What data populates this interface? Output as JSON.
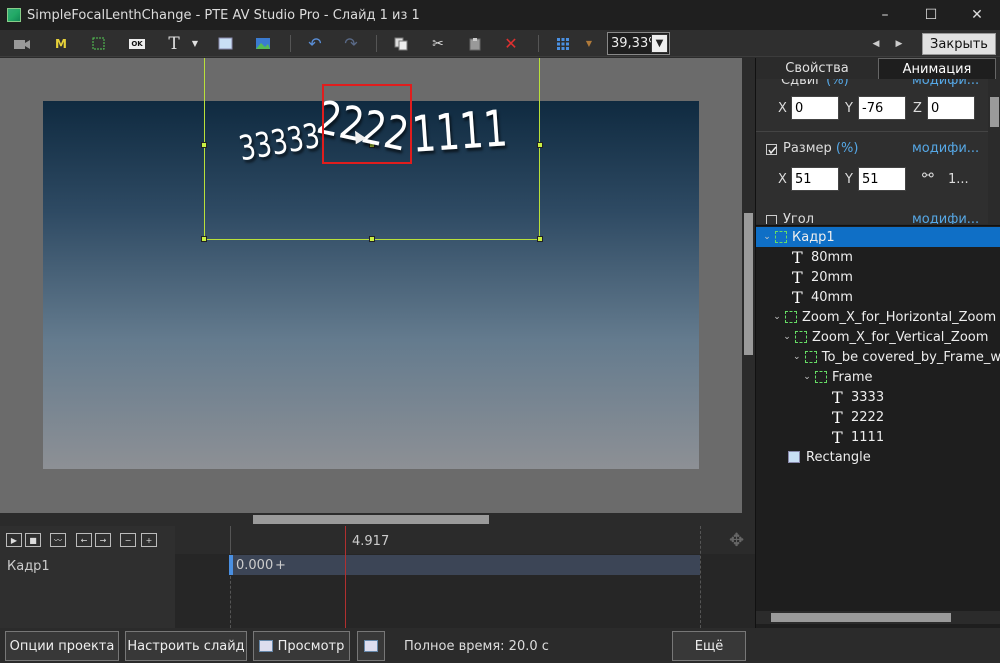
{
  "window": {
    "title": "SimpleFocalLenthChange - PTE AV Studio Pro - Слайд 1 из 1",
    "minimize": "–",
    "maximize": "☐",
    "close": "✕"
  },
  "toolbar": {
    "icons": [
      "camera-icon",
      "mask-icon",
      "frame-icon",
      "button-icon",
      "text-icon",
      "rectangle-icon",
      "image-icon",
      "undo-icon",
      "redo-icon",
      "copy-icon",
      "cut-icon",
      "paste-icon",
      "delete-icon",
      "grid-icon",
      "color-icon"
    ],
    "mask_label": "M",
    "text_label": "T",
    "button_label": "OK",
    "zoom_value": "39,33%",
    "nav_prev": "◀",
    "nav_next": "▶",
    "close_label": "Закрыть"
  },
  "canvas": {
    "text_3333": "33333",
    "text_2222": "2222",
    "text_1111": "1111"
  },
  "panel": {
    "tab_properties": "Свойства",
    "tab_animation": "Анимация",
    "shift_label": "Сдвиг",
    "shift_unit": "(%)",
    "shift_modify": "модифи...",
    "shift_x_label": "X",
    "shift_x": "0",
    "shift_y_label": "Y",
    "shift_y": "-76",
    "shift_z_label": "Z",
    "shift_z": "0",
    "size_label": "Размер",
    "size_unit": "(%)",
    "size_modify": "модифи...",
    "size_x_label": "X",
    "size_x": "51",
    "size_y_label": "Y",
    "size_y": "51",
    "size_link": "1...",
    "angle_label": "Угол",
    "angle_modify": "модифи..."
  },
  "tree": [
    {
      "label": "Кадр1",
      "type": "frame",
      "depth": 0,
      "expanded": true,
      "selected": true
    },
    {
      "label": "80mm",
      "type": "text",
      "depth": 1
    },
    {
      "label": "20mm",
      "type": "text",
      "depth": 1
    },
    {
      "label": "40mm",
      "type": "text",
      "depth": 1
    },
    {
      "label": "Zoom_X_for_Horizontal_Zoom",
      "type": "frame",
      "depth": 1,
      "expanded": true
    },
    {
      "label": "Zoom_X_for_Vertical_Zoom",
      "type": "frame",
      "depth": 2,
      "expanded": true
    },
    {
      "label": "To_be covered_by_Frame_w",
      "type": "frame",
      "depth": 3,
      "expanded": true
    },
    {
      "label": "Frame",
      "type": "frame",
      "depth": 4,
      "expanded": true
    },
    {
      "label": "3333",
      "type": "text",
      "depth": 5
    },
    {
      "label": "2222",
      "type": "text",
      "depth": 5
    },
    {
      "label": "1111",
      "type": "text",
      "depth": 5
    },
    {
      "label": "Rectangle",
      "type": "rect",
      "depth": 1
    }
  ],
  "timeline": {
    "current_time": "4.917",
    "track_name": "Кадр1",
    "keyframe_time": "0.000",
    "keyframe_plus": "+"
  },
  "bottom": {
    "project_options": "Опции проекта",
    "customize_slide": "Настроить слайд",
    "preview": "Просмотр",
    "total_time": "Полное время: 20.0 с",
    "more": "Ещё"
  },
  "colors": {
    "selection": "#0f6fc6",
    "frame_handle": "#c9ef44",
    "highlight_box": "#e01d1d",
    "link": "#56a8e6"
  }
}
